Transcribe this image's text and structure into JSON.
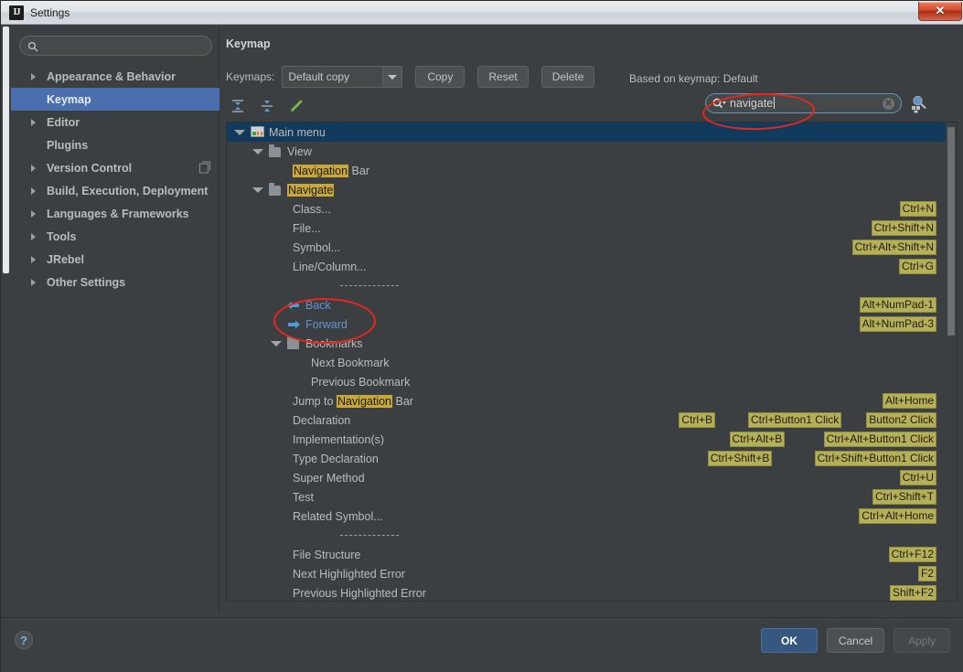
{
  "window": {
    "title": "Settings",
    "app_icon": "intellij-idea-icon",
    "close_label": "✕"
  },
  "sidebar": {
    "search": {
      "value": "",
      "placeholder": "",
      "icon": "search-icon"
    },
    "items": [
      {
        "label": "Appearance & Behavior",
        "expandable": true,
        "selected": false,
        "badge": null
      },
      {
        "label": "Keymap",
        "expandable": false,
        "selected": true,
        "badge": null
      },
      {
        "label": "Editor",
        "expandable": true,
        "selected": false,
        "badge": null
      },
      {
        "label": "Plugins",
        "expandable": false,
        "selected": false,
        "badge": null
      },
      {
        "label": "Version Control",
        "expandable": true,
        "selected": false,
        "badge": "copy-icon"
      },
      {
        "label": "Build, Execution, Deployment",
        "expandable": true,
        "selected": false,
        "badge": null
      },
      {
        "label": "Languages & Frameworks",
        "expandable": true,
        "selected": false,
        "badge": null
      },
      {
        "label": "Tools",
        "expandable": true,
        "selected": false,
        "badge": null
      },
      {
        "label": "JRebel",
        "expandable": true,
        "selected": false,
        "badge": null
      },
      {
        "label": "Other Settings",
        "expandable": true,
        "selected": false,
        "badge": null
      }
    ]
  },
  "main": {
    "page_title": "Keymap",
    "keymaps_label": "Keymaps:",
    "keymap_selected": "Default copy",
    "keymap_options": [
      "Default copy"
    ],
    "buttons": {
      "copy": "Copy",
      "reset": "Reset",
      "delete": "Delete"
    },
    "based_on": "Based on keymap: Default",
    "toolbar_icons": [
      "expand-all-icon",
      "collapse-all-icon",
      "edit-shortcut-icon"
    ],
    "search": {
      "value": "navigate",
      "icon": "search-dropdown-icon",
      "clear_icon": "clear-icon"
    },
    "find_by_shortcut_icon": "find-by-shortcut-icon"
  },
  "annotations": [
    {
      "name": "ink-ellipse-search",
      "color": "#e8261c",
      "target": "keymap search field"
    },
    {
      "name": "ink-ellipse-back-forward",
      "color": "#e8261c",
      "target": "Back / Forward rows"
    }
  ],
  "tree": {
    "highlight_term": "navigate",
    "rows": [
      {
        "indent": 0,
        "twisty": "down",
        "icon": "main-menu-icon",
        "label": "Main menu",
        "selected": true,
        "shortcuts": []
      },
      {
        "indent": 1,
        "twisty": "down",
        "icon": "folder-icon",
        "label": "View",
        "selected": false,
        "shortcuts": []
      },
      {
        "indent": 2,
        "twisty": null,
        "icon": null,
        "label": "Navigation Bar",
        "hl": "Navigation",
        "selected": false,
        "shortcuts": []
      },
      {
        "indent": 1,
        "twisty": "down",
        "icon": "folder-icon",
        "label": "Navigate",
        "hl": "Navigate",
        "selected": false,
        "shortcuts": []
      },
      {
        "indent": 2,
        "twisty": null,
        "icon": null,
        "label": "Class...",
        "selected": false,
        "shortcuts": [
          "Ctrl+N"
        ]
      },
      {
        "indent": 2,
        "twisty": null,
        "icon": null,
        "label": "File...",
        "selected": false,
        "shortcuts": [
          "Ctrl+Shift+N"
        ]
      },
      {
        "indent": 2,
        "twisty": null,
        "icon": null,
        "label": "Symbol...",
        "selected": false,
        "shortcuts": [
          "Ctrl+Alt+Shift+N"
        ]
      },
      {
        "indent": 2,
        "twisty": null,
        "icon": null,
        "label": "Line/Column...",
        "selected": false,
        "shortcuts": [
          "Ctrl+G"
        ]
      },
      {
        "indent": 2,
        "twisty": null,
        "icon": null,
        "label": "",
        "separator": true,
        "selected": false,
        "shortcuts": []
      },
      {
        "indent": 2,
        "twisty": null,
        "icon": "back-arrow-icon",
        "label": "Back",
        "blue": true,
        "selected": false,
        "shortcuts": [
          "Alt+NumPad-1"
        ]
      },
      {
        "indent": 2,
        "twisty": null,
        "icon": "forward-arrow-icon",
        "label": "Forward",
        "blue": true,
        "selected": false,
        "shortcuts": [
          "Alt+NumPad-3"
        ]
      },
      {
        "indent": 2,
        "twisty": "down",
        "icon": "folder-icon",
        "label": "Bookmarks",
        "selected": false,
        "shortcuts": []
      },
      {
        "indent": 3,
        "twisty": null,
        "icon": null,
        "label": "Next Bookmark",
        "selected": false,
        "shortcuts": []
      },
      {
        "indent": 3,
        "twisty": null,
        "icon": null,
        "label": "Previous Bookmark",
        "selected": false,
        "shortcuts": []
      },
      {
        "indent": 2,
        "twisty": null,
        "icon": null,
        "label": "Jump to Navigation Bar",
        "hl": "Navigation",
        "selected": false,
        "shortcuts": [
          "Alt+Home"
        ]
      },
      {
        "indent": 2,
        "twisty": null,
        "icon": null,
        "label": "Declaration",
        "selected": false,
        "shortcuts": [
          "Ctrl+B",
          "Ctrl+Button1 Click",
          "Button2 Click"
        ]
      },
      {
        "indent": 2,
        "twisty": null,
        "icon": null,
        "label": "Implementation(s)",
        "selected": false,
        "shortcuts": [
          "Ctrl+Alt+B",
          "Ctrl+Alt+Button1 Click"
        ]
      },
      {
        "indent": 2,
        "twisty": null,
        "icon": null,
        "label": "Type Declaration",
        "selected": false,
        "shortcuts": [
          "Ctrl+Shift+B",
          "Ctrl+Shift+Button1 Click"
        ]
      },
      {
        "indent": 2,
        "twisty": null,
        "icon": null,
        "label": "Super Method",
        "selected": false,
        "shortcuts": [
          "Ctrl+U"
        ]
      },
      {
        "indent": 2,
        "twisty": null,
        "icon": null,
        "label": "Test",
        "selected": false,
        "shortcuts": [
          "Ctrl+Shift+T"
        ]
      },
      {
        "indent": 2,
        "twisty": null,
        "icon": null,
        "label": "Related Symbol...",
        "selected": false,
        "shortcuts": [
          "Ctrl+Alt+Home"
        ]
      },
      {
        "indent": 2,
        "twisty": null,
        "icon": null,
        "label": "",
        "separator": true,
        "selected": false,
        "shortcuts": []
      },
      {
        "indent": 2,
        "twisty": null,
        "icon": null,
        "label": "File Structure",
        "selected": false,
        "shortcuts": [
          "Ctrl+F12"
        ]
      },
      {
        "indent": 2,
        "twisty": null,
        "icon": null,
        "label": "Next Highlighted Error",
        "selected": false,
        "shortcuts": [
          "F2"
        ]
      },
      {
        "indent": 2,
        "twisty": null,
        "icon": null,
        "label": "Previous Highlighted Error",
        "selected": false,
        "shortcuts": [
          "Shift+F2"
        ]
      }
    ]
  },
  "footer": {
    "help_label": "?",
    "ok_label": "OK",
    "cancel_label": "Cancel",
    "apply_label": "Apply"
  },
  "colors": {
    "accent_selection": "#4b6eaf",
    "tree_selection": "#113a5c",
    "highlight_match": "#c8a838",
    "shortcut_badge": "#b5b055",
    "link_blue": "#5f93d0",
    "ink_red": "#e8261c",
    "panel_bg": "#3c3f41"
  }
}
